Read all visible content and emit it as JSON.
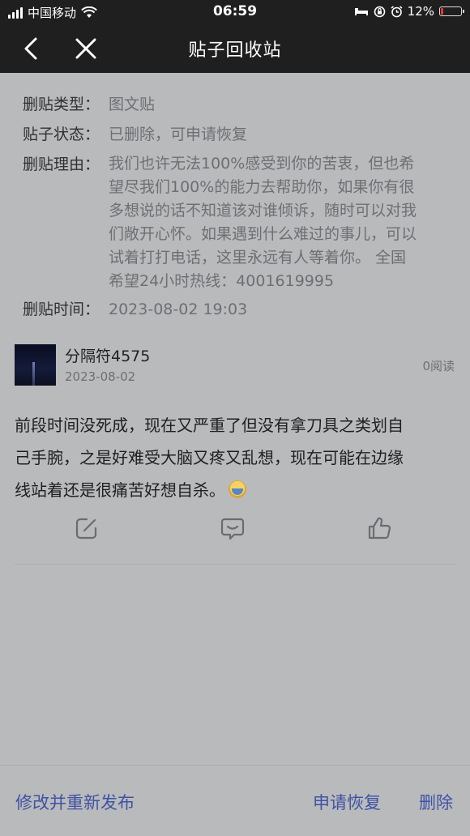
{
  "status_bar": {
    "carrier": "中国移动",
    "time": "06:59",
    "battery": "12%"
  },
  "nav": {
    "title": "贴子回收站",
    "back_icon": "chevron-left-icon",
    "close_icon": "close-icon"
  },
  "meta": {
    "type_label": "删贴类型：",
    "type_value": "图文贴",
    "state_label": "贴子状态：",
    "state_value": "已删除，可申请恢复",
    "reason_label": "删贴理由：",
    "reason_lines": [
      "我们也许无法100%感受到你的苦衷，但也希",
      "望尽我们100%的能力去帮助你，如果你有很",
      "多想说的话不知道该对谁倾诉，随时可以对我",
      "们敞开心怀。如果遇到什么难过的事儿，可以",
      "试着打打电话，这里永远有人等着你。 全国",
      "希望24小时热线：4001619995"
    ],
    "time_label": "删贴时间：",
    "time_value": "2023-08-02 19:03"
  },
  "post": {
    "author": "分隔符4575",
    "date": "2023-08-02",
    "reads": "0阅读",
    "body_lines": [
      "前段时间没死成，现在又严重了但没有拿刀具之类划自",
      "己手腕，之是好难受大脑又疼又乱想，现在可能在边缘",
      "线站着还是很痛苦好想自杀。"
    ]
  },
  "actions": {
    "edit_icon": "edit-icon",
    "comment_icon": "comment-icon",
    "like_icon": "thumbs-up-icon"
  },
  "bottom": {
    "republish": "修改并重新发布",
    "restore": "申请恢复",
    "delete": "删除"
  },
  "colors": {
    "background": "#b9babb",
    "topbar": "#1f1f1f",
    "link": "#3f52a6",
    "battery_low": "#e53935"
  }
}
